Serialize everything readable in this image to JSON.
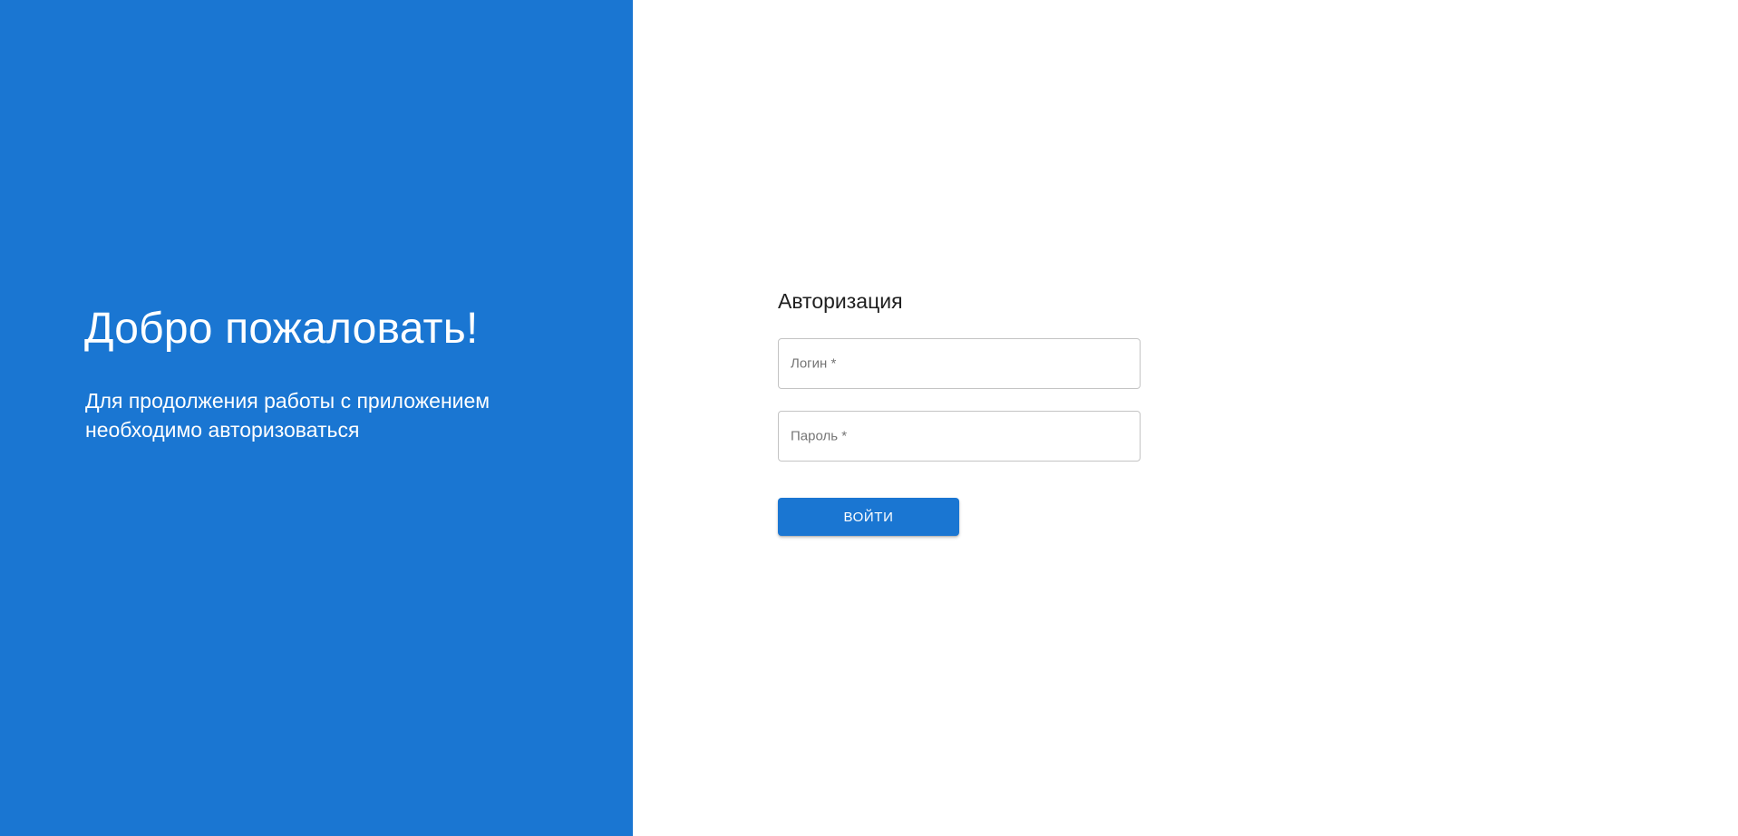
{
  "colors": {
    "brand_blue": "#1a76d2",
    "panel_text": "#ffffff",
    "field_border": "#c4c4c4",
    "label_gray": "#757575"
  },
  "welcome": {
    "title": "Добро пожаловать!",
    "subtitle": "Для продолжения работы с приложением необходимо авторизоваться"
  },
  "login_form": {
    "title": "Авторизация",
    "login_field": {
      "label": "Логин *",
      "value": ""
    },
    "password_field": {
      "label": "Пароль *",
      "value": ""
    },
    "submit_label": "Войти"
  }
}
